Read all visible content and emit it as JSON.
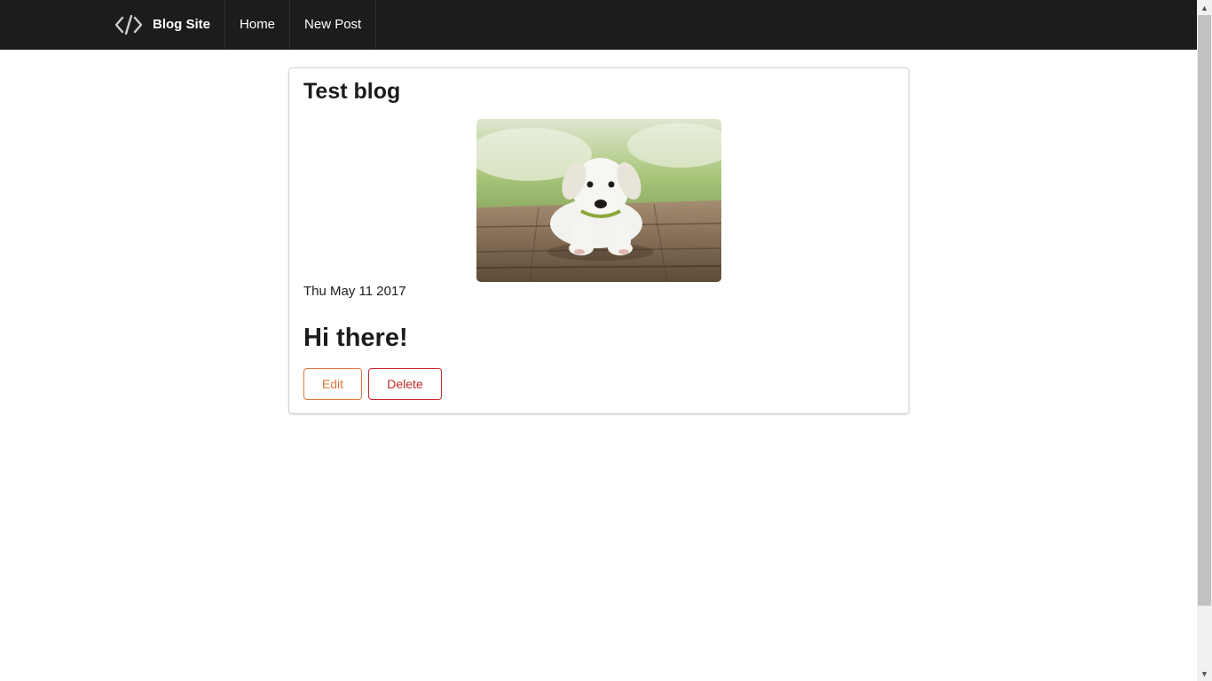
{
  "nav": {
    "brand_label": "Blog Site",
    "brand_icon": "code-icon",
    "items": [
      {
        "label": "Home"
      },
      {
        "label": "New Post"
      }
    ],
    "background": "#1b1c1d"
  },
  "post": {
    "title": "Test blog",
    "image": "puppy-photo",
    "date": "Thu May 11 2017",
    "body": "Hi there!",
    "actions": {
      "edit_label": "Edit",
      "delete_label": "Delete"
    }
  },
  "colors": {
    "edit": "#e0773a",
    "delete": "#c62828"
  }
}
